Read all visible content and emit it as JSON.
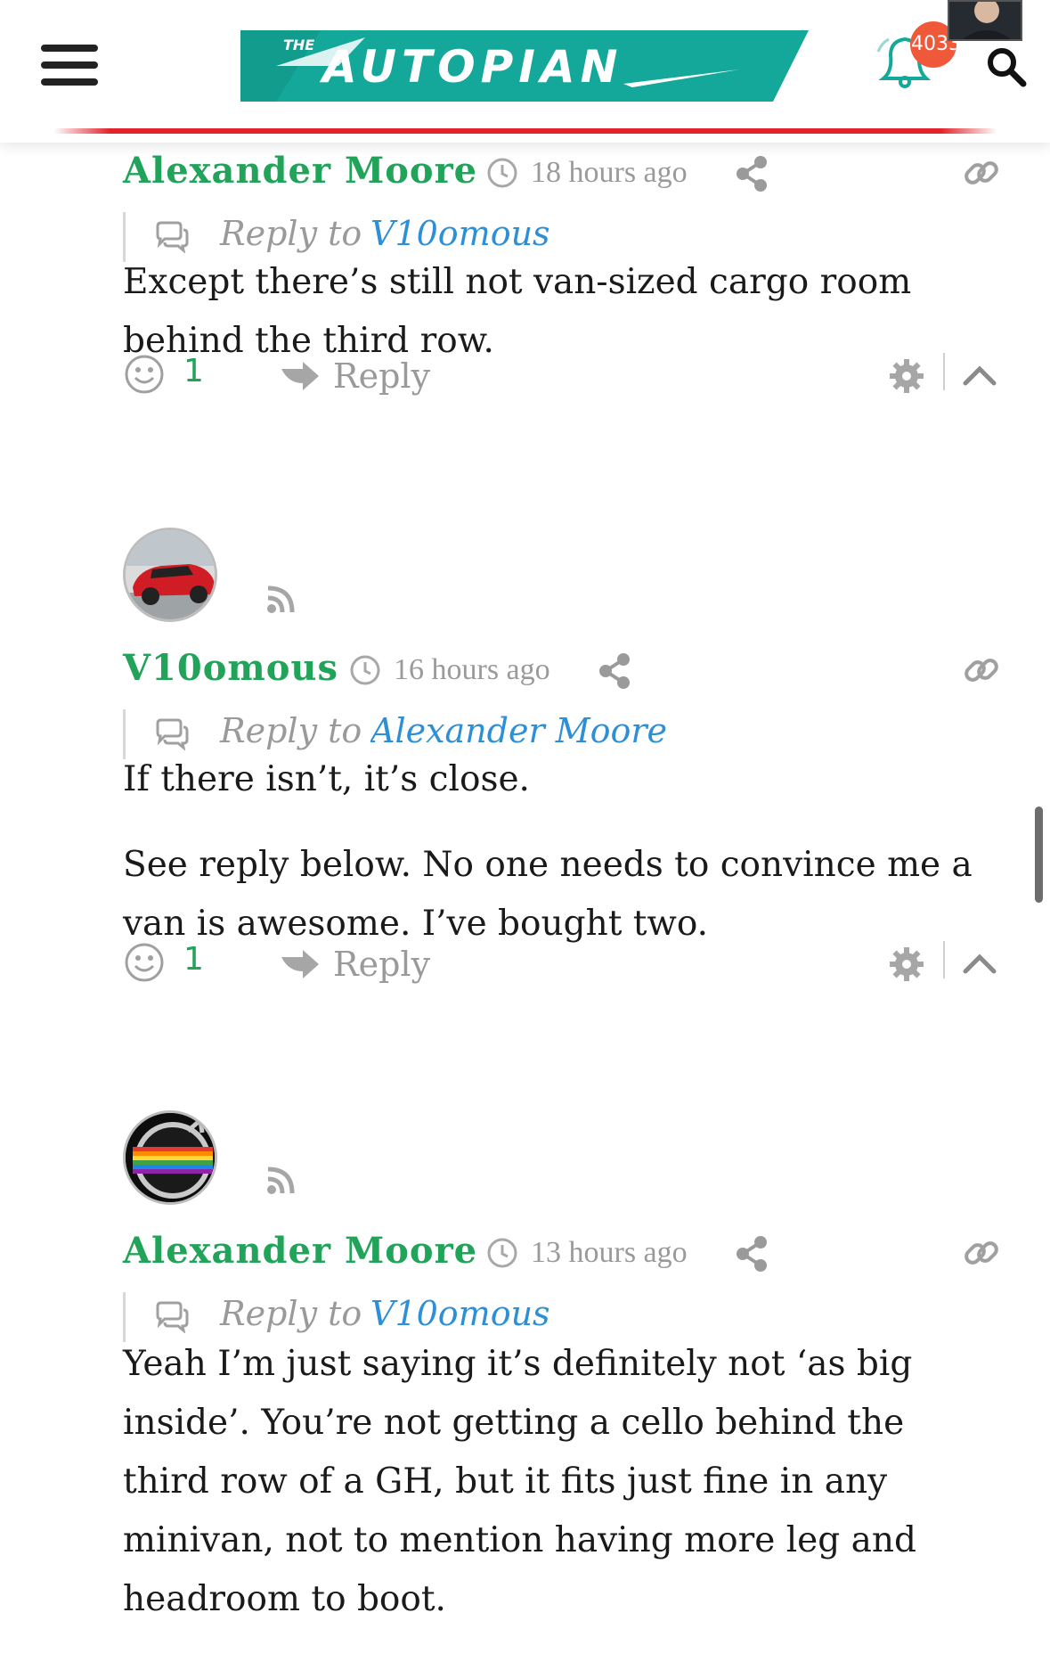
{
  "header": {
    "logo_text": "THE AUTOPIAN",
    "notification_count": "4033",
    "menu_icon": "hamburger-menu-icon",
    "search_icon": "search-icon",
    "bell_icon": "bell-icon",
    "brand_color": "#14a89a",
    "accent_line_color": "#e2232b"
  },
  "comments": [
    {
      "author": "Alexander Moore",
      "time": "18 hours ago",
      "reply_prefix": "Reply to",
      "reply_to": "V10omous",
      "body": [
        "Except there’s still not van-sized cargo room behind the third row."
      ],
      "votes": "1",
      "reply_label": "Reply"
    },
    {
      "author": "V10omous",
      "time": "16 hours ago",
      "reply_prefix": "Reply to",
      "reply_to": "Alexander Moore",
      "body": [
        "If there isn’t, it’s close.",
        "See reply below. No one needs to convince me a van is awesome. I’ve bought two."
      ],
      "votes": "1",
      "reply_label": "Reply",
      "avatar": "red-sports-car-avatar"
    },
    {
      "author": "Alexander Moore",
      "time": "13 hours ago",
      "reply_prefix": "Reply to",
      "reply_to": "V10omous",
      "body": [
        "Yeah I’m just saying it’s definitely not ‘as big inside’. You’re not getting a cello behind the third row of a GH, but it fits just fine in any minivan, not to mention having more leg and headroom to boot."
      ],
      "avatar": "rainbow-volvo-emblem-avatar"
    }
  ],
  "colors": {
    "author_green": "#21a35a",
    "link_blue": "#2d8fd5",
    "muted_gray": "#9a9a9a"
  }
}
